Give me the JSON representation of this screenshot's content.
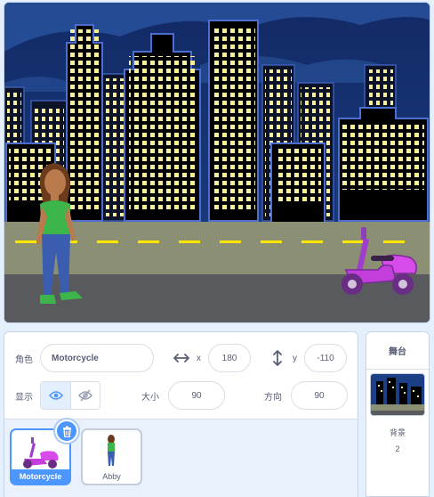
{
  "sprite_info": {
    "sprite_label": "角色",
    "sprite_name": "Motorcycle",
    "x_label": "x",
    "x_value": "180",
    "y_label": "y",
    "y_value": "-110",
    "show_label": "显示",
    "size_label": "大小",
    "size_value": "90",
    "direction_label": "方向",
    "direction_value": "90"
  },
  "sprites": [
    {
      "name": "Motorcycle",
      "selected": true
    },
    {
      "name": "Abby",
      "selected": false
    }
  ],
  "stage_panel": {
    "title": "舞台",
    "backdrop_label": "背景",
    "backdrop_count": "2"
  },
  "colors": {
    "accent": "#4c97ff",
    "text": "#575e75",
    "sky": "#162e6b",
    "road": "#8b8f74"
  },
  "icons": {
    "show": "eye-icon",
    "hide": "eye-slash-icon",
    "x": "horizontal-arrows-icon",
    "y": "vertical-arrows-icon",
    "delete": "trash-icon"
  }
}
